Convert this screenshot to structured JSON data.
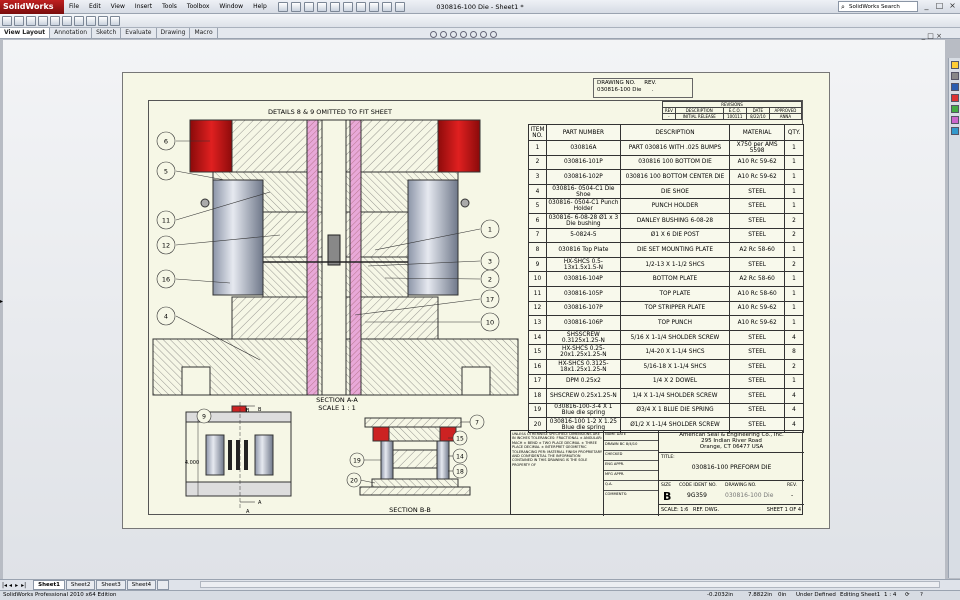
{
  "app": {
    "logo": "SolidWorks",
    "doc_title": "030816-100 Die - Sheet1 *"
  },
  "menu": [
    "File",
    "Edit",
    "View",
    "Insert",
    "Tools",
    "Toolbox",
    "Window",
    "Help"
  ],
  "search": {
    "label": "SolidWorks Search"
  },
  "window_controls": [
    "_",
    "□",
    "×"
  ],
  "cmd_tabs": [
    "View Layout",
    "Annotation",
    "Sketch",
    "Evaluate",
    "Drawing",
    "Macro"
  ],
  "graphics_controls": "_ □ ×",
  "drawing": {
    "top_dwg_label": "DRAWING NO.",
    "top_rev_label": "REV.",
    "top_dwg_no": "030816-100 Die",
    "top_rev": ".",
    "detail_note": "DETAILS 8 & 9 OMITTED TO FIT SHEET",
    "section_aa": "SECTION A-A",
    "section_aa_scale": "SCALE 1 : 1",
    "section_bb": "SECTION B-B",
    "dim_4000": "4.000",
    "balloons_main": [
      "6",
      "5",
      "11",
      "12",
      "16",
      "4",
      "1",
      "3",
      "2",
      "17",
      "10"
    ],
    "balloons_small": [
      "9",
      "7",
      "15",
      "14",
      "19",
      "18",
      "20"
    ],
    "arrow_labels": [
      "B",
      "B",
      "A",
      "A"
    ],
    "rev_table": {
      "title": "REVISIONS",
      "headers": [
        "REV",
        "DESCRIPTION",
        "E.C.O.",
        "DATE",
        "APPROVED"
      ],
      "row": [
        "-",
        "INITIAL RELEASE",
        "100111",
        "8/22/10",
        "ANNA"
      ]
    }
  },
  "bom": {
    "headers": [
      "ITEM NO.",
      "PART NUMBER",
      "DESCRIPTION",
      "MATERIAL",
      "QTY."
    ],
    "rows": [
      [
        "1",
        "030816A",
        "PART 030816 WITH .025 BUMPS",
        "X750 per AMS 5598",
        "1"
      ],
      [
        "2",
        "030816-101P",
        "030816 100 BOTTOM DIE",
        "A10 Rc 59-62",
        "1"
      ],
      [
        "3",
        "030816-102P",
        "030816 100 BOTTOM CENTER DIE",
        "A10 Rc 59-62",
        "1"
      ],
      [
        "4",
        "030816- 0504-C1 Die Shoe",
        "DIE SHOE",
        "STEEL",
        "1"
      ],
      [
        "5",
        "030816- 0504-C1 Punch Holder",
        "PUNCH HOLDER",
        "STEEL",
        "1"
      ],
      [
        "6",
        "030816- 6-08-28 Ø1 x 3 Die bushing",
        "DANLEY BUSHING 6-08-28",
        "STEEL",
        "2"
      ],
      [
        "7",
        "5-0824-5",
        "Ø1 X 6 DIE POST",
        "STEEL",
        "2"
      ],
      [
        "8",
        "030816 Top Plate",
        "DIE SET MOUNTING PLATE",
        "A2 Rc 58-60",
        "1"
      ],
      [
        "9",
        "HX-SHCS 0.5-13x1.5x1.5-N",
        "1/2-13 X 1-1/2 SHCS",
        "STEEL",
        "2"
      ],
      [
        "10",
        "030816-104P",
        "BOTTOM PLATE",
        "A2 Rc 58-60",
        "1"
      ],
      [
        "11",
        "030816-105P",
        "TOP PLATE",
        "A10 Rc 58-60",
        "1"
      ],
      [
        "12",
        "030816-107P",
        "TOP STRIPPER PLATE",
        "A10 Rc 59-62",
        "1"
      ],
      [
        "13",
        "030816-106P",
        "TOP PUNCH",
        "A10 Rc 59-62",
        "1"
      ],
      [
        "14",
        "SHSSCREW 0.3125x1.25-N",
        "5/16 X 1-1/4 SHOLDER SCREW",
        "STEEL",
        "4"
      ],
      [
        "15",
        "HX-SHCS 0.25-20x1.25x1.25-N",
        "1/4-20 X 1-1/4 SHCS",
        "STEEL",
        "8"
      ],
      [
        "16",
        "HX-SHCS 0.3125-18x1.25x1.25-N",
        "5/16-18 X 1-1/4 SHCS",
        "STEEL",
        "2"
      ],
      [
        "17",
        "DPM 0.25x2",
        "1/4 X 2 DOWEL",
        "STEEL",
        "1"
      ],
      [
        "18",
        "SHSCREW 0.25x1.25-N",
        "1/4 X 1-1/4 SHOLDER SCREW",
        "STEEL",
        "4"
      ],
      [
        "19",
        "030816-100-3-4 X 1 Blue die spring",
        "Ø3/4 X 1 BLUE DIE SPRING",
        "STEEL",
        "4"
      ],
      [
        "20",
        "030816-100 1-2 X 1.25 Blue die spring",
        "Ø1/2 X 1-1/4 SHOLDER SCREW",
        "STEEL",
        "4"
      ]
    ]
  },
  "title_block": {
    "notes": "UNLESS OTHERWISE SPECIFIED: DIMENSIONS ARE IN INCHES TOLERANCES: FRACTIONAL ± ANGULAR: MACH ± BEND ± TWO PLACE DECIMAL ± THREE PLACE DECIMAL ± INTERPRET GEOMETRIC TOLERANCING PER: MATERIAL FINISH PROPRIETARY AND CONFIDENTIAL THE INFORMATION CONTAINED IN THIS DRAWING IS THE SOLE PROPERTY OF",
    "names": [
      "NAME   DATE",
      "DRAWN   BC   8/4/10",
      "CHECKED",
      "ENG APPR.",
      "MFG APPR.",
      "Q.A.",
      "COMMENTS:"
    ],
    "company": "American Seal & Engineering Co., Inc.",
    "address1": "295 Indian River Road",
    "address2": "Orange, CT 06477 USA",
    "title_label": "TITLE:",
    "title": "030816-100 PREFORM DIE",
    "size_label": "SIZE",
    "size": "B",
    "code_label": "CODE IDENT NO.",
    "code": "9G359",
    "dwg_label": "DRAWING NO.",
    "dwg": "030816-100 Die",
    "rev_label": "REV.",
    "rev": "-",
    "scale": "SCALE: 1:6",
    "ref": "REF. DWG.",
    "sheet": "SHEET 1 OF 4"
  },
  "sheet_tabs": [
    "Sheet1",
    "Sheet2",
    "Sheet3",
    "Sheet4"
  ],
  "status": {
    "edition": "SolidWorks Professional 2010 x64 Edition",
    "x": "-0.2032in",
    "y": "7.8822in",
    "z": "0in",
    "state": "Under Defined",
    "editing": "Editing Sheet1",
    "scale": "1 : 4"
  },
  "colors": {
    "accent": "#c02020",
    "highlight_red": "#d11a1a",
    "pink": "#e8a8d8"
  }
}
